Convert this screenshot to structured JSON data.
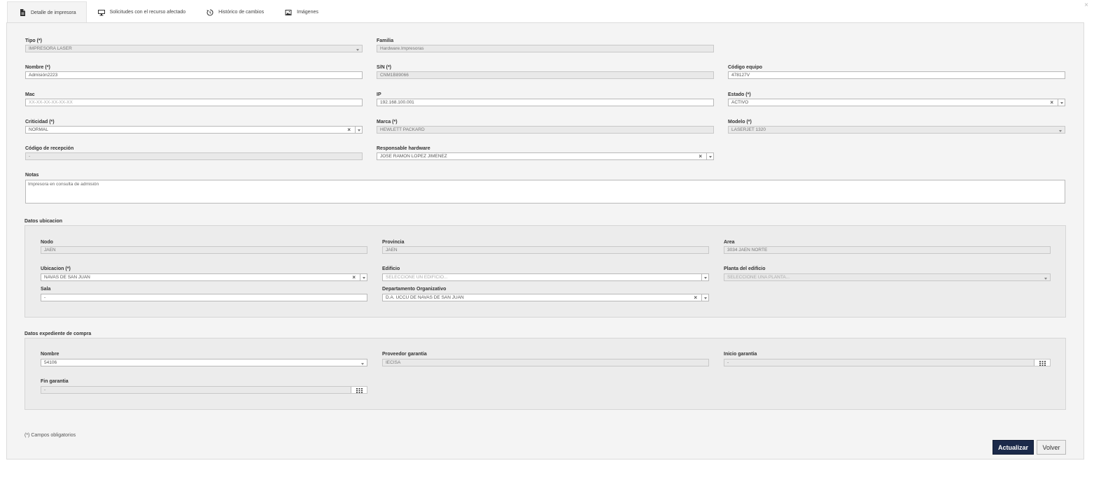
{
  "tabs": [
    {
      "label": "Detalle de impresora",
      "icon": "document-icon"
    },
    {
      "label": "Solicitudes con el recurso afectado",
      "icon": "monitor-icon"
    },
    {
      "label": "Histórico de cambios",
      "icon": "history-icon"
    },
    {
      "label": "Imágenes",
      "icon": "image-icon"
    }
  ],
  "close_label": "×",
  "fields": {
    "tipo": {
      "label": "Tipo (*)",
      "value": "IMPRESORA LASER"
    },
    "familia": {
      "label": "Familia",
      "value": "Hardware.Impresoras"
    },
    "nombre": {
      "label": "Nombre (*)",
      "value": "Admisión2223"
    },
    "sn": {
      "label": "S/N (*)",
      "value": "CNM1B89066"
    },
    "codigo_equipo": {
      "label": "Código equipo",
      "value": "478127V"
    },
    "mac": {
      "label": "Mac",
      "placeholder": "XX-XX-XX-XX-XX-XX"
    },
    "ip": {
      "label": "IP",
      "value": "192.168.100.001"
    },
    "estado": {
      "label": "Estado (*)",
      "value": "ACTIVO"
    },
    "criticidad": {
      "label": "Criticidad (*)",
      "value": "NORMAL"
    },
    "marca": {
      "label": "Marca (*)",
      "value": "HEWLETT PACKARD"
    },
    "modelo": {
      "label": "Modelo (*)",
      "value": "LASERJET 1320"
    },
    "codigo_recepcion": {
      "label": "Código de recepción",
      "value": "-"
    },
    "responsable": {
      "label": "Responsable hardware",
      "value": "JOSE RAMON LOPEZ JIMENEZ"
    },
    "notas": {
      "label": "Notas",
      "value": "Impresora en consulta de admisión"
    }
  },
  "ubicacion": {
    "title": "Datos ubicacion",
    "nodo": {
      "label": "Nodo",
      "value": "JAEN"
    },
    "provincia": {
      "label": "Provincia",
      "value": "JAEN"
    },
    "area": {
      "label": "Area",
      "value": "3034 JAEN NORTE"
    },
    "ubicacion": {
      "label": "Ubicacion (*)",
      "value": "NAVAS DE SAN JUAN"
    },
    "edificio": {
      "label": "Edificio",
      "placeholder": "SELECCIONE UN EDIFICIO..."
    },
    "planta": {
      "label": "Planta del edificio",
      "placeholder": "SELECCIONE UNA PLANTA..."
    },
    "sala": {
      "label": "Sala",
      "value": "-"
    },
    "departamento": {
      "label": "Departamento Organizativo",
      "value": "D.A. UCCU DE NAVAS DE SAN JUAN"
    }
  },
  "compra": {
    "title": "Datos expediente de compra",
    "nombre": {
      "label": "Nombre",
      "value": "54106"
    },
    "proveedor": {
      "label": "Proveedor garantia",
      "value": "IECISA"
    },
    "inicio": {
      "label": "Inicio garantia",
      "value": "-"
    },
    "fin": {
      "label": "Fin garantia",
      "value": "-"
    }
  },
  "footnote": "(*) Campos obligatorios",
  "buttons": {
    "update": "Actualizar",
    "back": "Volver"
  },
  "clear_glyph": "×",
  "colors": {
    "primary_button": "#1b2a4a",
    "panel": "#f4f4f4",
    "subpanel": "#ececec"
  }
}
